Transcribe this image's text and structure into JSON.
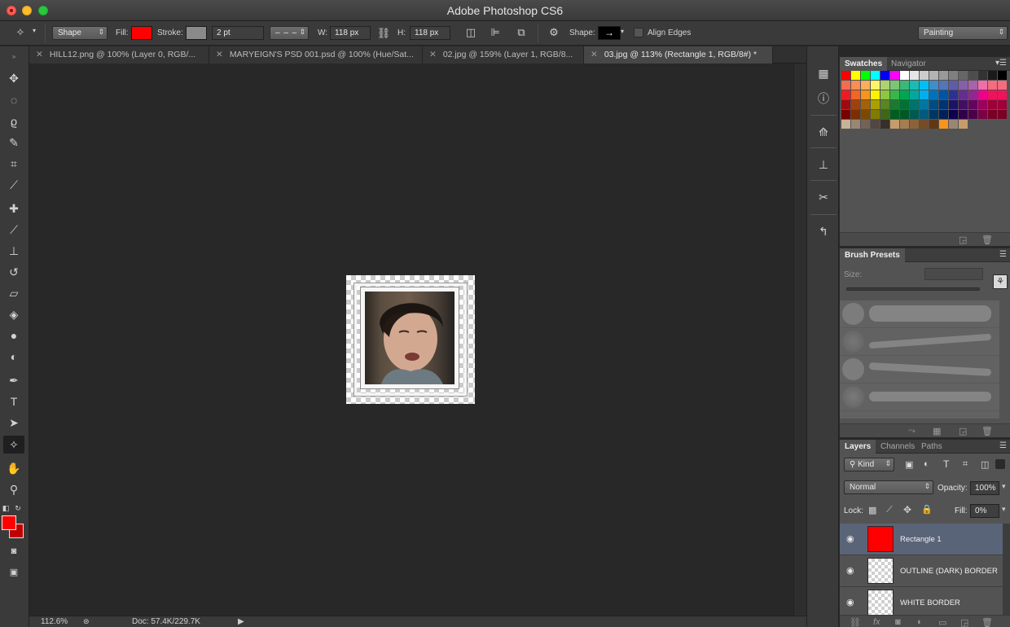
{
  "app": {
    "title": "Adobe Photoshop CS6"
  },
  "options": {
    "mode": "Shape",
    "fill_label": "Fill:",
    "fill_color": "#ff0000",
    "stroke_label": "Stroke:",
    "stroke_width": "2 pt",
    "w_label": "W:",
    "w_value": "118 px",
    "h_label": "H:",
    "h_value": "118 px",
    "shape_label": "Shape:",
    "align_edges": "Align Edges",
    "workspace": "Painting"
  },
  "tabs": [
    {
      "label": "HILL12.png @ 100% (Layer 0, RGB/..."
    },
    {
      "label": "MARYEIGN'S PSD 001.psd @ 100% (Hue/Sat..."
    },
    {
      "label": "02.jpg @ 159% (Layer 1, RGB/8..."
    },
    {
      "label": "03.jpg @ 113% (Rectangle 1, RGB/8#) *"
    }
  ],
  "status": {
    "zoom": "112.6%",
    "doc": "Doc: 57.4K/229.7K"
  },
  "panels": {
    "swatches_tab": "Swatches",
    "navigator_tab": "Navigator",
    "brush_presets_tab": "Brush Presets",
    "size_label": "Size:",
    "layers_tab": "Layers",
    "channels_tab": "Channels",
    "paths_tab": "Paths",
    "kind": "Kind",
    "blend_mode": "Normal",
    "opacity_label": "Opacity:",
    "opacity_value": "100%",
    "lock_label": "Lock:",
    "fill_label": "Fill:",
    "fill_value": "0%"
  },
  "layers": [
    {
      "name": "Rectangle 1",
      "selected": true
    },
    {
      "name": "OUTLINE (DARK) BORDER",
      "selected": false
    },
    {
      "name": "WHITE BORDER",
      "selected": false
    }
  ]
}
